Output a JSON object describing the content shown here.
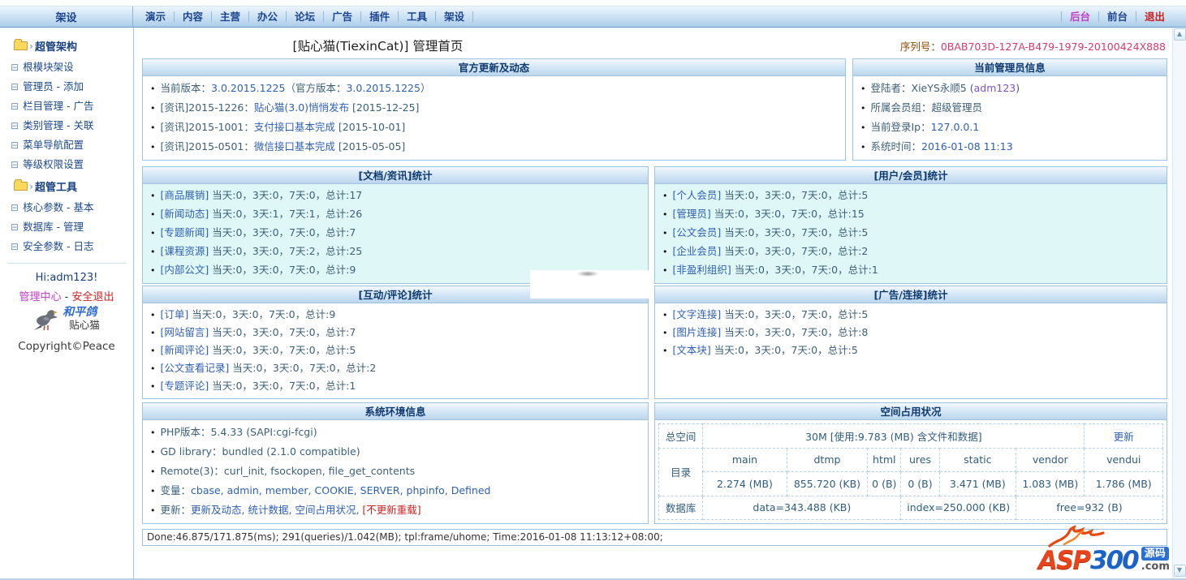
{
  "icons": {
    "scroll_up": "▲",
    "scroll_down": "▼",
    "bullet": "•",
    "tree": "⊟",
    "caret": "›"
  },
  "topbar": {
    "sidebar_tab": "架设",
    "menu": [
      "演示",
      "内容",
      "主营",
      "办公",
      "论坛",
      "广告",
      "插件",
      "工具",
      "架设"
    ],
    "right_links": [
      {
        "label": "后台",
        "style": "magenta"
      },
      {
        "label": "前台",
        "style": "navy"
      },
      {
        "label": "退出",
        "style": "red"
      }
    ]
  },
  "sidebar": {
    "items": [
      {
        "type": "folder",
        "label": "超管架构"
      },
      {
        "type": "item",
        "label": "根模块架设"
      },
      {
        "type": "item",
        "label": "管理员 - 添加"
      },
      {
        "type": "item",
        "label": "栏目管理 - 广告"
      },
      {
        "type": "item",
        "label": "类别管理 - 关联"
      },
      {
        "type": "item",
        "label": "菜单导航配置"
      },
      {
        "type": "item",
        "label": "等级权限设置"
      },
      {
        "type": "folder",
        "label": "超管工具"
      },
      {
        "type": "item",
        "label": "核心参数 - 基本"
      },
      {
        "type": "item",
        "label": "数据库 - 管理"
      },
      {
        "type": "item",
        "label": "安全参数 - 日志"
      }
    ],
    "greeting": "Hi:adm123!",
    "center_link": "管理中心",
    "link_sep": " - ",
    "logout_link": "安全退出",
    "pigeon_caption": "和平鸽",
    "brand": "贴心猫",
    "copyright": "Copyright©Peace"
  },
  "header": {
    "title": "[贴心猫(TiexinCat)] 管理首页",
    "serial_label": "序列号：",
    "serial_value": "0BAB703D-127A-B479-1979-20100424X888"
  },
  "panels": {
    "updates": {
      "title": "官方更新及动态",
      "items": [
        [
          {
            "t": "当前版本：",
            "s": "p"
          },
          {
            "t": "3.0.2015.1225",
            "s": "l"
          },
          {
            "t": "（官方版本：",
            "s": "p"
          },
          {
            "t": "3.0.2015.1225",
            "s": "l"
          },
          {
            "t": "）",
            "s": "p"
          }
        ],
        [
          {
            "t": "[资讯]2015-1226：",
            "s": "p"
          },
          {
            "t": "贴心猫(3.0)悄悄发布",
            "s": "l"
          },
          {
            "t": " [2015-12-25]",
            "s": "p"
          }
        ],
        [
          {
            "t": "[资讯]2015-1001：",
            "s": "p"
          },
          {
            "t": "支付接口基本完成",
            "s": "l"
          },
          {
            "t": " [2015-10-01]",
            "s": "p"
          }
        ],
        [
          {
            "t": "[资讯]2015-0501：",
            "s": "p"
          },
          {
            "t": "微信接口基本完成",
            "s": "l"
          },
          {
            "t": " [2015-05-05]",
            "s": "p"
          }
        ]
      ]
    },
    "admin_info": {
      "title": "当前管理员信息",
      "items": [
        [
          {
            "t": "登陆者：XieYS永顺5 (",
            "s": "p"
          },
          {
            "t": "adm123",
            "s": "v"
          },
          {
            "t": ")",
            "s": "p"
          }
        ],
        [
          {
            "t": "所属会员组：超级管理员",
            "s": "p"
          }
        ],
        [
          {
            "t": "当前登录Ip：",
            "s": "p"
          },
          {
            "t": "127.0.0.1",
            "s": "l"
          }
        ],
        [
          {
            "t": "系统时间：",
            "s": "p"
          },
          {
            "t": "2016-01-08 11:13",
            "s": "l"
          }
        ]
      ]
    },
    "doc_stats": {
      "title": "[文档/资讯]统计",
      "items": [
        [
          {
            "t": "[商品展销]",
            "s": "l"
          },
          {
            "t": " 当天:0，3天:0，7天:0，总计:17",
            "s": "p"
          }
        ],
        [
          {
            "t": "[新闻动态]",
            "s": "l"
          },
          {
            "t": " 当天:0，3天:1，7天:1，总计:26",
            "s": "p"
          }
        ],
        [
          {
            "t": "[专题新闻]",
            "s": "l"
          },
          {
            "t": " 当天:0，3天:0，7天:0，总计:7",
            "s": "p"
          }
        ],
        [
          {
            "t": "[课程资源]",
            "s": "l"
          },
          {
            "t": " 当天:0，3天:0，7天:2，总计:25",
            "s": "p"
          }
        ],
        [
          {
            "t": "[内部公文]",
            "s": "l"
          },
          {
            "t": " 当天:0，3天:0，7天:0，总计:9",
            "s": "p"
          }
        ]
      ]
    },
    "user_stats": {
      "title": "[用户/会员]统计",
      "items": [
        [
          {
            "t": "[个人会员]",
            "s": "l"
          },
          {
            "t": " 当天:0，3天:0，7天:0，总计:5",
            "s": "p"
          }
        ],
        [
          {
            "t": "[管理员]",
            "s": "l"
          },
          {
            "t": " 当天:0，3天:0，7天:0，总计:15",
            "s": "p"
          }
        ],
        [
          {
            "t": "[公文会员]",
            "s": "l"
          },
          {
            "t": " 当天:0，3天:0，7天:0，总计:5",
            "s": "p"
          }
        ],
        [
          {
            "t": "[企业会员]",
            "s": "l"
          },
          {
            "t": " 当天:0，3天:0，7天:0，总计:2",
            "s": "p"
          }
        ],
        [
          {
            "t": "[非盈利组织]",
            "s": "l"
          },
          {
            "t": " 当天:0，3天:0，7天:0，总计:1",
            "s": "p"
          }
        ]
      ]
    },
    "comment_stats": {
      "title": "[互动/评论]统计",
      "items": [
        [
          {
            "t": "[订单]",
            "s": "l"
          },
          {
            "t": " 当天:0，3天:0，7天:0，总计:9",
            "s": "p"
          }
        ],
        [
          {
            "t": "[网站留言]",
            "s": "l"
          },
          {
            "t": " 当天:0，3天:0，7天:0，总计:7",
            "s": "p"
          }
        ],
        [
          {
            "t": "[新闻评论]",
            "s": "l"
          },
          {
            "t": " 当天:0，3天:0，7天:0，总计:5",
            "s": "p"
          }
        ],
        [
          {
            "t": "[公文查看记录]",
            "s": "l"
          },
          {
            "t": " 当天:0，3天:0，7天:0，总计:2",
            "s": "p"
          }
        ],
        [
          {
            "t": "[专题评论]",
            "s": "l"
          },
          {
            "t": " 当天:0，3天:0，7天:0，总计:1",
            "s": "p"
          }
        ]
      ]
    },
    "ad_stats": {
      "title": "[广告/连接]统计",
      "items": [
        [
          {
            "t": "[文字连接]",
            "s": "l"
          },
          {
            "t": " 当天:0，3天:0，7天:0，总计:5",
            "s": "p"
          }
        ],
        [
          {
            "t": "[图片连接]",
            "s": "l"
          },
          {
            "t": " 当天:0，3天:0，7天:0，总计:8",
            "s": "p"
          }
        ],
        [
          {
            "t": "[文本块]",
            "s": "l"
          },
          {
            "t": " 当天:0，3天:0，7天:0，总计:5",
            "s": "p"
          }
        ]
      ]
    },
    "sysenv": {
      "title": "系统环境信息",
      "items": [
        [
          {
            "t": "PHP版本：5.4.33 (SAPI:cgi-fcgi)",
            "s": "p"
          }
        ],
        [
          {
            "t": "GD library：bundled (2.1.0 compatible)",
            "s": "p"
          }
        ],
        [
          {
            "t": "Remote(3)：curl_init, fsockopen, file_get_contents",
            "s": "p"
          }
        ],
        [
          {
            "t": "变量：",
            "s": "p"
          },
          {
            "t": "cbase, admin, member, COOKIE, SERVER, phpinfo, Defined",
            "s": "l"
          }
        ],
        [
          {
            "t": "更新：",
            "s": "p"
          },
          {
            "t": "更新及动态",
            "s": "l"
          },
          {
            "t": ", ",
            "s": "p"
          },
          {
            "t": "统计数据",
            "s": "l"
          },
          {
            "t": ", ",
            "s": "p"
          },
          {
            "t": "空间占用状况",
            "s": "l"
          },
          {
            "t": ", ",
            "s": "p"
          },
          {
            "t": "[不更新重载]",
            "s": "r"
          }
        ]
      ]
    },
    "space": {
      "title": "空间占用状况",
      "total_label": "总空间",
      "total_value": "30M [使用:9.783 (MB) 含文件和数据]",
      "refresh": "更新",
      "dir_label": "目录",
      "dirs": [
        {
          "name": "main",
          "size": "2.274 (MB)"
        },
        {
          "name": "dtmp",
          "size": "855.720 (KB)"
        },
        {
          "name": "html",
          "size": "0 (B)"
        },
        {
          "name": "ures",
          "size": "0 (B)"
        },
        {
          "name": "static",
          "size": "3.471 (MB)"
        },
        {
          "name": "vendor",
          "size": "1.083 (MB)"
        },
        {
          "name": "vendui",
          "size": "1.786 (MB)"
        }
      ],
      "db_label": "数据库",
      "db_values": [
        "data=343.488 (KB)",
        "index=250.000 (KB)",
        "free=932 (B)"
      ]
    }
  },
  "statusbar": "Done:46.875/171.875(ms); 291(queries)/1.042(MB); tpl:frame/uhome; Time:2016-01-08 11:13:12+08:00;",
  "logo": {
    "asp": "ASP",
    "num": "300",
    "badge": "源码",
    "com": ".com"
  },
  "colors": {
    "accent_blue": "#2d5fb4",
    "header_navy": "#0f3a70",
    "serial_red": "#d63b6a",
    "magenta": "#c43bc4",
    "red": "#cc2020",
    "cyan_bg": "#e0f7f7"
  }
}
